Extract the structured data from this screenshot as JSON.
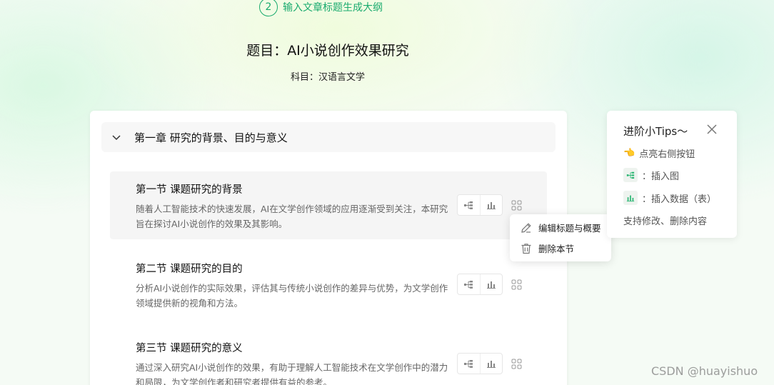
{
  "step": {
    "number": "2",
    "label": "输入文章标题生成大纲"
  },
  "paper": {
    "title": "题目：AI小说创作效果研究",
    "subject": "科目：汉语言文学"
  },
  "chapter": {
    "title": "第一章 研究的背景、目的与意义",
    "icon": "chevron-down-icon"
  },
  "sections": [
    {
      "title": "第一节 课题研究的背景",
      "desc": "随着人工智能技术的快速发展，AI在文学创作领域的应用逐渐受到关注，本研究旨在探讨AI小说创作的效果及其影响。"
    },
    {
      "title": "第二节 课题研究的目的",
      "desc": "分析AI小说创作的实际效果，评估其与传统小说创作的差异与优势，为文学创作领域提供新的视角和方法。"
    },
    {
      "title": "第三节 课题研究的意义",
      "desc": "通过深入研究AI小说创作的效果，有助于理解人工智能技术在文学创作中的潜力和局限，为文学创作者和研究者提供有益的参考。"
    }
  ],
  "toolbar_icons": [
    "mindmap-icon",
    "bar-chart-icon",
    "grid-menu-icon"
  ],
  "context_menu": {
    "edit_label": "编辑标题与概要",
    "delete_label": "删除本节",
    "edit_icon": "pencil-icon",
    "delete_icon": "trash-icon"
  },
  "tips": {
    "title": "进阶小Tips～",
    "hint": "点亮右侧按钮",
    "insert_image": "：插入图",
    "insert_data": "：插入数据（表）",
    "support": "支持修改、删除内容",
    "close_icon": "close-icon"
  },
  "watermark": "CSDN @huayishuo",
  "colors": {
    "accent": "#1aab6e",
    "icon_green": "#2bb673"
  }
}
